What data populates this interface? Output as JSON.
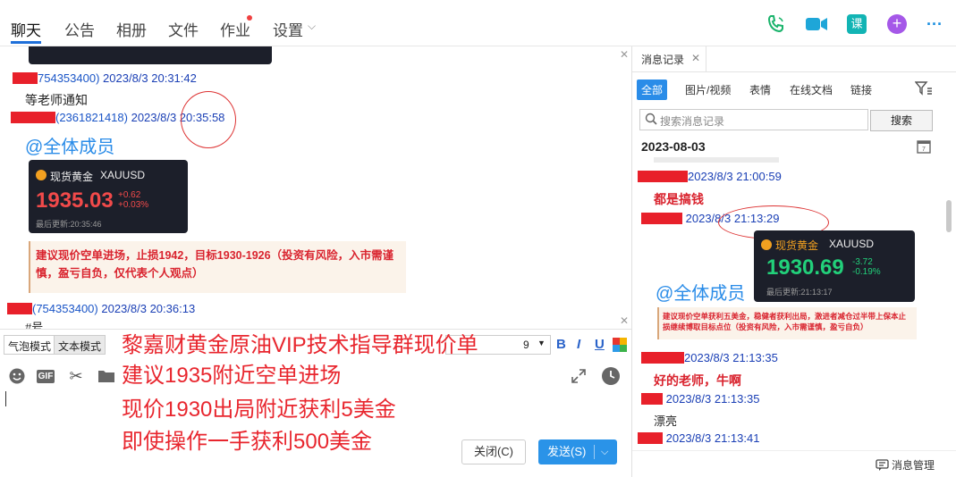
{
  "tabs": [
    {
      "label": "聊天"
    },
    {
      "label": "公告"
    },
    {
      "label": "相册"
    },
    {
      "label": "文件"
    },
    {
      "label": "作业"
    },
    {
      "label": "设置"
    }
  ],
  "chat": {
    "m1_id": "754353400)",
    "m1_time": "2023/8/3 20:31:42",
    "m1_text": "等老师通知",
    "m2_id": "(2361821418)",
    "m2_time": "2023/8/3 20:35:58",
    "mention": "@全体成员",
    "card": {
      "name": "现货黄金",
      "symbol": "XAUUSD",
      "price": "1935.03",
      "chg1": "+0.62",
      "chg2": "+0.03%",
      "updated": "最后更新:20:35:46"
    },
    "advice": "建议现价空单进场，止损1942，目标1930-1926（投资有风险，入市需谨慎，盈亏自负，仅代表个人观点）",
    "m3_id": "(754353400)",
    "m3_time": "2023/8/3 20:36:13",
    "m3_partial": "#号"
  },
  "toolbar": {
    "bubble_mode": "气泡模式",
    "text_mode": "文本模式",
    "font_size": "9",
    "bold": "B",
    "italic": "I",
    "underline": "U"
  },
  "buttons": {
    "close": "关闭(C)",
    "send": "发送(S)"
  },
  "overlay": [
    "黎嘉财黄金原油VIP技术指导群现价单",
    "建议1935附近空单进场",
    "现价1930出局附近获利5美金",
    "即使操作一手获利500美金"
  ],
  "right_panel": {
    "tab": "消息记录",
    "filters": [
      "全部",
      "图片/视频",
      "表情",
      "在线文档",
      "链接"
    ],
    "search_placeholder": "搜索消息记录",
    "search_btn": "搜索",
    "date": "2023-08-03",
    "r1_time": "2023/8/3 21:00:59",
    "r1_text": "都是搞钱",
    "r2_time": "2023/8/3 21:13:29",
    "card": {
      "name": "现货黄金",
      "symbol": "XAUUSD",
      "price": "1930.69",
      "chg1": "-3.72",
      "chg2": "-0.19%",
      "updated": "最后更新:21:13:17"
    },
    "mention": "@全体成员",
    "advice": "建议现价空单获利五美金，稳健者获利出局，激进者减仓过半带上保本止损继续博取目标点位（投资有风险，入市需谨慎，盈亏自负）",
    "r3_time": "2023/8/3 21:13:35",
    "r3_text": "好的老师，牛啊",
    "r4_time": "2023/8/3 21:13:35",
    "r4_text": "漂亮",
    "r5_time": "2023/8/3 21:13:41",
    "manage": "消息管理"
  }
}
